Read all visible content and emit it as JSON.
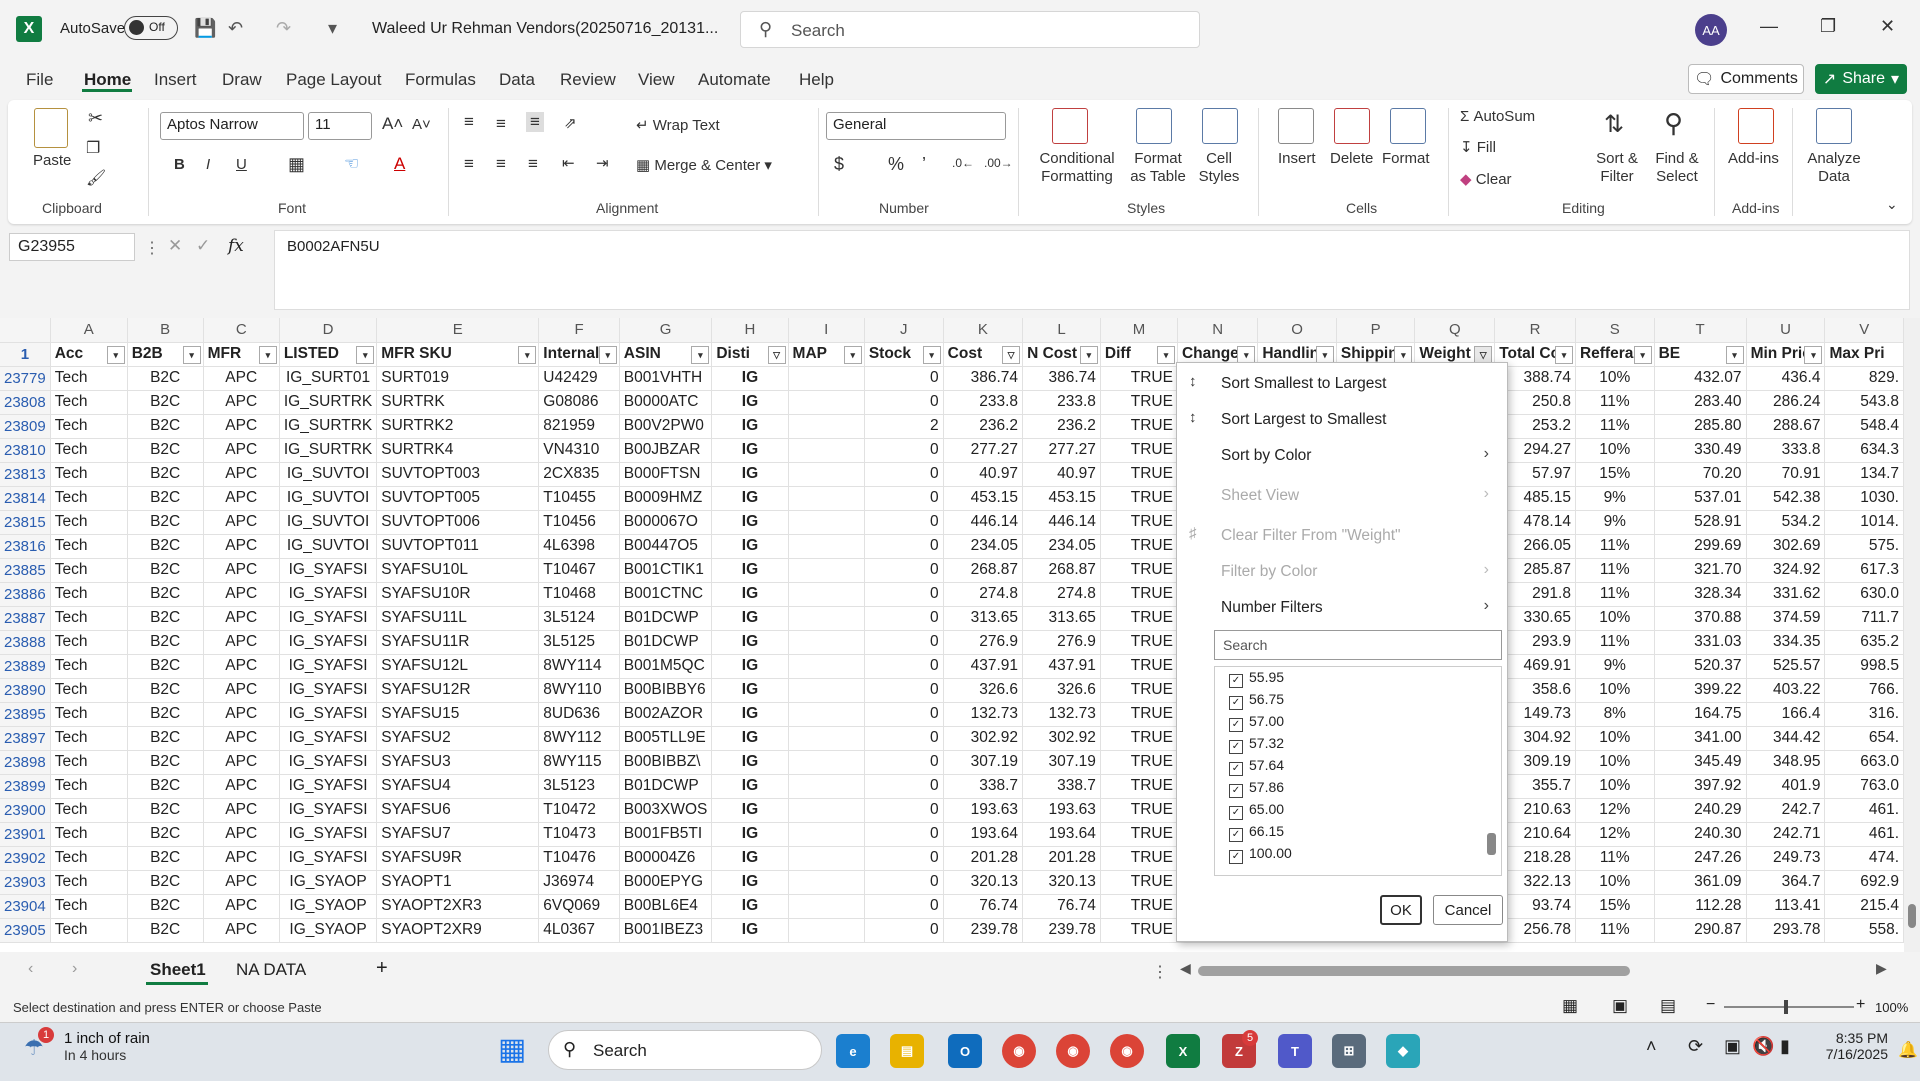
{
  "titlebar": {
    "autosave_label": "AutoSave",
    "autosave_state": "Off",
    "filename": "Waleed Ur Rehman Vendors(20250716_20131...",
    "search_placeholder": "Search",
    "avatar_initials": "AA"
  },
  "menu": {
    "items": [
      "File",
      "Home",
      "Insert",
      "Draw",
      "Page Layout",
      "Formulas",
      "Data",
      "Review",
      "View",
      "Automate",
      "Help"
    ],
    "comments": "Comments",
    "share": "Share"
  },
  "ribbon": {
    "paste": "Paste",
    "clipboard": "Clipboard",
    "font_name": "Aptos Narrow",
    "font_size": "11",
    "font": "Font",
    "wrap_text": "Wrap Text",
    "merge_center": "Merge & Center",
    "alignment": "Alignment",
    "number_format": "General",
    "number": "Number",
    "conditional_formatting": "Conditional Formatting",
    "format_as_table": "Format as Table",
    "cell_styles": "Cell Styles",
    "styles": "Styles",
    "insert": "Insert",
    "delete": "Delete",
    "format": "Format",
    "cells": "Cells",
    "autosum": "AutoSum",
    "fill": "Fill",
    "clear": "Clear",
    "sort_filter": "Sort & Filter",
    "find_select": "Find & Select",
    "editing": "Editing",
    "addins": "Add-ins",
    "addins_group": "Add-ins",
    "analyze_data": "Analyze Data"
  },
  "formula_bar": {
    "name_box": "G23955",
    "value": "B0002AFN5U"
  },
  "sheet": {
    "col_letters": [
      "A",
      "B",
      "C",
      "D",
      "E",
      "F",
      "G",
      "H",
      "I",
      "J",
      "K",
      "L",
      "M",
      "N",
      "O",
      "P",
      "Q",
      "R",
      "S",
      "T",
      "U",
      "V"
    ],
    "header_row_number": "1",
    "headers": [
      "Acc",
      "B2B",
      "MFR",
      "LISTED",
      "MFR SKU",
      "Internal",
      "ASIN",
      "Disti",
      "MAP",
      "Stock",
      "Cost",
      "N Cost",
      "Diff",
      "Change",
      "Handlin",
      "Shippin",
      "Weight",
      "Total Co",
      "Refferal",
      "BE",
      "Min Pric",
      "Max Pri"
    ],
    "rows": [
      {
        "n": "23779",
        "c": [
          "Tech",
          "B2C",
          "APC",
          "IG_SURT01",
          "SURT019",
          "U42429",
          "B001VHTH",
          "IG",
          "",
          "0",
          "386.74",
          "386.74",
          "TRUE",
          "",
          "",
          "",
          "",
          "388.74",
          "10%",
          "432.07",
          "436.4",
          "829."
        ]
      },
      {
        "n": "23808",
        "c": [
          "Tech",
          "B2C",
          "APC",
          "IG_SURTRK",
          "SURTRK",
          "G08086",
          "B0000ATC",
          "IG",
          "",
          "0",
          "233.8",
          "233.8",
          "TRUE",
          "",
          "",
          "",
          "",
          "250.8",
          "11%",
          "283.40",
          "286.24",
          "543.8"
        ]
      },
      {
        "n": "23809",
        "c": [
          "Tech",
          "B2C",
          "APC",
          "IG_SURTRK",
          "SURTRK2",
          "821959",
          "B00V2PW0",
          "IG",
          "",
          "2",
          "236.2",
          "236.2",
          "TRUE",
          "",
          "",
          "",
          "",
          "253.2",
          "11%",
          "285.80",
          "288.67",
          "548.4"
        ]
      },
      {
        "n": "23810",
        "c": [
          "Tech",
          "B2C",
          "APC",
          "IG_SURTRK",
          "SURTRK4",
          "VN4310",
          "B00JBZAR",
          "IG",
          "",
          "0",
          "277.27",
          "277.27",
          "TRUE",
          "",
          "",
          "",
          "",
          "294.27",
          "10%",
          "330.49",
          "333.8",
          "634.3"
        ]
      },
      {
        "n": "23813",
        "c": [
          "Tech",
          "B2C",
          "APC",
          "IG_SUVTOI",
          "SUVTOPT003",
          "2CX835",
          "B000FTSN",
          "IG",
          "",
          "0",
          "40.97",
          "40.97",
          "TRUE",
          "",
          "",
          "",
          "",
          "57.97",
          "15%",
          "70.20",
          "70.91",
          "134.7"
        ]
      },
      {
        "n": "23814",
        "c": [
          "Tech",
          "B2C",
          "APC",
          "IG_SUVTOI",
          "SUVTOPT005",
          "T10455",
          "B0009HMZ",
          "IG",
          "",
          "0",
          "453.15",
          "453.15",
          "TRUE",
          "",
          "",
          "",
          "",
          "485.15",
          "9%",
          "537.01",
          "542.38",
          "1030."
        ]
      },
      {
        "n": "23815",
        "c": [
          "Tech",
          "B2C",
          "APC",
          "IG_SUVTOI",
          "SUVTOPT006",
          "T10456",
          "B000067O",
          "IG",
          "",
          "0",
          "446.14",
          "446.14",
          "TRUE",
          "",
          "",
          "",
          "",
          "478.14",
          "9%",
          "528.91",
          "534.2",
          "1014."
        ]
      },
      {
        "n": "23816",
        "c": [
          "Tech",
          "B2C",
          "APC",
          "IG_SUVTOI",
          "SUVTOPT011",
          "4L6398",
          "B00447O5",
          "IG",
          "",
          "0",
          "234.05",
          "234.05",
          "TRUE",
          "",
          "",
          "",
          "",
          "266.05",
          "11%",
          "299.69",
          "302.69",
          "575."
        ]
      },
      {
        "n": "23885",
        "c": [
          "Tech",
          "B2C",
          "APC",
          "IG_SYAFSI",
          "SYAFSU10L",
          "T10467",
          "B001CTIK1",
          "IG",
          "",
          "0",
          "268.87",
          "268.87",
          "TRUE",
          "",
          "",
          "",
          "",
          "285.87",
          "11%",
          "321.70",
          "324.92",
          "617.3"
        ]
      },
      {
        "n": "23886",
        "c": [
          "Tech",
          "B2C",
          "APC",
          "IG_SYAFSI",
          "SYAFSU10R",
          "T10468",
          "B001CTNC",
          "IG",
          "",
          "0",
          "274.8",
          "274.8",
          "TRUE",
          "",
          "",
          "",
          "",
          "291.8",
          "11%",
          "328.34",
          "331.62",
          "630.0"
        ]
      },
      {
        "n": "23887",
        "c": [
          "Tech",
          "B2C",
          "APC",
          "IG_SYAFSI",
          "SYAFSU11L",
          "3L5124",
          "B01DCWP",
          "IG",
          "",
          "0",
          "313.65",
          "313.65",
          "TRUE",
          "",
          "",
          "",
          "",
          "330.65",
          "10%",
          "370.88",
          "374.59",
          "711.7"
        ]
      },
      {
        "n": "23888",
        "c": [
          "Tech",
          "B2C",
          "APC",
          "IG_SYAFSI",
          "SYAFSU11R",
          "3L5125",
          "B01DCWP",
          "IG",
          "",
          "0",
          "276.9",
          "276.9",
          "TRUE",
          "",
          "",
          "",
          "",
          "293.9",
          "11%",
          "331.03",
          "334.35",
          "635.2"
        ]
      },
      {
        "n": "23889",
        "c": [
          "Tech",
          "B2C",
          "APC",
          "IG_SYAFSI",
          "SYAFSU12L",
          "8WY114",
          "B001M5QC",
          "IG",
          "",
          "0",
          "437.91",
          "437.91",
          "TRUE",
          "",
          "",
          "",
          "",
          "469.91",
          "9%",
          "520.37",
          "525.57",
          "998.5"
        ]
      },
      {
        "n": "23890",
        "c": [
          "Tech",
          "B2C",
          "APC",
          "IG_SYAFSI",
          "SYAFSU12R",
          "8WY110",
          "B00BIBBY6",
          "IG",
          "",
          "0",
          "326.6",
          "326.6",
          "TRUE",
          "",
          "",
          "",
          "",
          "358.6",
          "10%",
          "399.22",
          "403.22",
          "766."
        ]
      },
      {
        "n": "23895",
        "c": [
          "Tech",
          "B2C",
          "APC",
          "IG_SYAFSI",
          "SYAFSU15",
          "8UD636",
          "B002AZOR",
          "IG",
          "",
          "0",
          "132.73",
          "132.73",
          "TRUE",
          "",
          "",
          "",
          "",
          "149.73",
          "8%",
          "164.75",
          "166.4",
          "316."
        ]
      },
      {
        "n": "23897",
        "c": [
          "Tech",
          "B2C",
          "APC",
          "IG_SYAFSI",
          "SYAFSU2",
          "8WY112",
          "B005TLL9E",
          "IG",
          "",
          "0",
          "302.92",
          "302.92",
          "TRUE",
          "",
          "",
          "",
          "",
          "304.92",
          "10%",
          "341.00",
          "344.42",
          "654."
        ]
      },
      {
        "n": "23898",
        "c": [
          "Tech",
          "B2C",
          "APC",
          "IG_SYAFSI",
          "SYAFSU3",
          "8WY115",
          "B00BIBBZ\\",
          "IG",
          "",
          "0",
          "307.19",
          "307.19",
          "TRUE",
          "",
          "",
          "",
          "",
          "309.19",
          "10%",
          "345.49",
          "348.95",
          "663.0"
        ]
      },
      {
        "n": "23899",
        "c": [
          "Tech",
          "B2C",
          "APC",
          "IG_SYAFSI",
          "SYAFSU4",
          "3L5123",
          "B01DCWP",
          "IG",
          "",
          "0",
          "338.7",
          "338.7",
          "TRUE",
          "",
          "",
          "",
          "",
          "355.7",
          "10%",
          "397.92",
          "401.9",
          "763.0"
        ]
      },
      {
        "n": "23900",
        "c": [
          "Tech",
          "B2C",
          "APC",
          "IG_SYAFSI",
          "SYAFSU6",
          "T10472",
          "B003XWOS",
          "IG",
          "",
          "0",
          "193.63",
          "193.63",
          "TRUE",
          "",
          "",
          "",
          "",
          "210.63",
          "12%",
          "240.29",
          "242.7",
          "461."
        ]
      },
      {
        "n": "23901",
        "c": [
          "Tech",
          "B2C",
          "APC",
          "IG_SYAFSI",
          "SYAFSU7",
          "T10473",
          "B001FB5TI",
          "IG",
          "",
          "0",
          "193.64",
          "193.64",
          "TRUE",
          "",
          "",
          "",
          "",
          "210.64",
          "12%",
          "240.30",
          "242.71",
          "461."
        ]
      },
      {
        "n": "23902",
        "c": [
          "Tech",
          "B2C",
          "APC",
          "IG_SYAFSI",
          "SYAFSU9R",
          "T10476",
          "B00004Z6",
          "IG",
          "",
          "0",
          "201.28",
          "201.28",
          "TRUE",
          "",
          "",
          "",
          "",
          "218.28",
          "11%",
          "247.26",
          "249.73",
          "474."
        ]
      },
      {
        "n": "23903",
        "c": [
          "Tech",
          "B2C",
          "APC",
          "IG_SYAOP",
          "SYAOPT1",
          "J36974",
          "B000EPYG",
          "IG",
          "",
          "0",
          "320.13",
          "320.13",
          "TRUE",
          "",
          "",
          "",
          "",
          "322.13",
          "10%",
          "361.09",
          "364.7",
          "692.9"
        ]
      },
      {
        "n": "23904",
        "c": [
          "Tech",
          "B2C",
          "APC",
          "IG_SYAOP",
          "SYAOPT2XR3",
          "6VQ069",
          "B00BL6E4",
          "IG",
          "",
          "0",
          "76.74",
          "76.74",
          "TRUE",
          "",
          "",
          "",
          "",
          "93.74",
          "15%",
          "112.28",
          "113.41",
          "215.4"
        ]
      },
      {
        "n": "23905",
        "c": [
          "Tech",
          "B2C",
          "APC",
          "IG_SYAOP",
          "SYAOPT2XR9",
          "4L0367",
          "B001IBEZ3",
          "IG",
          "",
          "0",
          "239.78",
          "239.78",
          "TRUE",
          "",
          "",
          "",
          "",
          "256.78",
          "11%",
          "290.87",
          "293.78",
          "558."
        ]
      }
    ]
  },
  "filter_menu": {
    "sort_asc": "Sort Smallest to Largest",
    "sort_desc": "Sort Largest to Smallest",
    "sort_color": "Sort by Color",
    "sheet_view": "Sheet View",
    "clear_filter": "Clear Filter From \"Weight\"",
    "filter_color": "Filter by Color",
    "number_filters": "Number Filters",
    "search_placeholder": "Search",
    "values": [
      "55.95",
      "56.75",
      "57.00",
      "57.32",
      "57.64",
      "57.86",
      "65.00",
      "66.15",
      "100.00"
    ],
    "ok": "OK",
    "cancel": "Cancel"
  },
  "tabs": {
    "sheet1": "Sheet1",
    "na_data": "NA DATA"
  },
  "status": {
    "message": "Select destination and press ENTER or choose Paste",
    "zoom": "100%"
  },
  "taskbar": {
    "weather_title": "1 inch of rain",
    "weather_sub": "In 4 hours",
    "search_placeholder": "Search",
    "time": "8:35 PM",
    "date": "7/16/2025",
    "zoom_badge": "5"
  },
  "colors": {
    "accent": "#107c41",
    "row_number": "#2a5db0"
  }
}
